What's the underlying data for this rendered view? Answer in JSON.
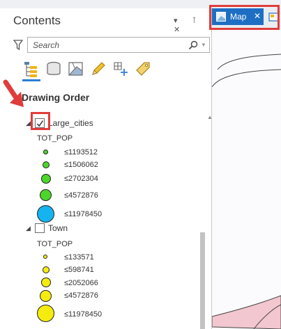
{
  "contents": {
    "title": "Contents",
    "pane_controls": "▾ ⊺ ✕",
    "search": {
      "placeholder": "Search"
    },
    "tabs": [
      "list-by-drawing-order",
      "list-by-data-source",
      "list-by-selection",
      "list-by-editing",
      "list-by-snapping",
      "list-by-labeling"
    ],
    "section": "Drawing Order",
    "layers": [
      {
        "name": "Large_cities",
        "checked": true,
        "field": "TOT_POP",
        "color": "#4cd629",
        "classes": [
          "≤1193512",
          "≤1506062",
          "≤2702304",
          "≤4572876",
          "≤11978450"
        ],
        "last_color": "#15b4f0"
      },
      {
        "name": "Town",
        "checked": false,
        "field": "TOT_POP",
        "color": "#f5ec0f",
        "classes": [
          "≤133571",
          "≤598741",
          "≤2052066",
          "≤4572876",
          "≤11978450"
        ]
      }
    ]
  },
  "map": {
    "tab_label": "Map",
    "close": "✕",
    "accent": "#1e6fc4",
    "boundary_color": "#f3c7cf"
  },
  "highlight_color": "#e03c3c"
}
